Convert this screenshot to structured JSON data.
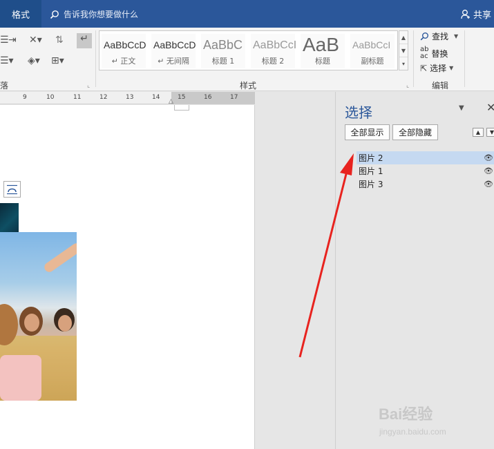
{
  "topbar": {
    "tab_label": "格式",
    "tellme_text": "告诉我你想要做什么",
    "share_label": "共享"
  },
  "ribbon": {
    "paragraph_group_label": "落",
    "styles_group_label": "样式",
    "editing_group_label": "编辑",
    "styles": [
      {
        "sample": "AaBbCcD",
        "name": "↵ 正文"
      },
      {
        "sample": "AaBbCcD",
        "name": "↵ 无间隔"
      },
      {
        "sample": "AaBbC",
        "name": "标题 1"
      },
      {
        "sample": "AaBbCcI",
        "name": "标题 2"
      },
      {
        "sample": "AaB",
        "name": "标题"
      },
      {
        "sample": "AaBbCcI",
        "name": "副标题"
      }
    ],
    "editing": {
      "find_label": "查找",
      "replace_label": "替换",
      "select_label": "选择"
    }
  },
  "ruler": {
    "numbers": [
      "9",
      "10",
      "11",
      "12",
      "13",
      "14",
      "15",
      "16",
      "17"
    ]
  },
  "selection_pane": {
    "title": "选择",
    "show_all_label": "全部显示",
    "hide_all_label": "全部隐藏",
    "items": [
      {
        "label": "图片 2",
        "selected": true
      },
      {
        "label": "图片 1",
        "selected": false
      },
      {
        "label": "图片 3",
        "selected": false
      }
    ]
  },
  "watermark": {
    "brand": "Bai经验",
    "url": "jingyan.baidu.com"
  },
  "colors": {
    "accent": "#2b579a",
    "selection": "#c5d9f1",
    "arrow": "#e8231f"
  }
}
